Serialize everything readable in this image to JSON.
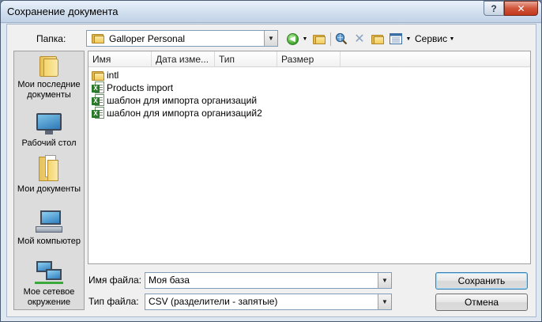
{
  "window": {
    "title": "Сохранение документа",
    "help_glyph": "?",
    "close_glyph": "✕"
  },
  "toolbar": {
    "folder_label": "Папка:",
    "folder_value": "Galloper Personal",
    "service_label": "Сервис"
  },
  "places": [
    {
      "label": "Мои последние документы",
      "icon": "recent-documents-icon"
    },
    {
      "label": "Рабочий стол",
      "icon": "desktop-icon"
    },
    {
      "label": "Мои документы",
      "icon": "my-documents-icon"
    },
    {
      "label": "Мой компьютер",
      "icon": "my-computer-icon"
    },
    {
      "label": "Мое сетевое окружение",
      "icon": "network-places-icon"
    }
  ],
  "filelist": {
    "columns": [
      "Имя",
      "Дата изме...",
      "Тип",
      "Размер"
    ],
    "items": [
      {
        "name": "intl",
        "icon": "folder-icon"
      },
      {
        "name": "Products import",
        "icon": "excel-file-icon"
      },
      {
        "name": "шаблон для импорта организаций",
        "icon": "excel-file-icon"
      },
      {
        "name": "шаблон для импорта организаций2",
        "icon": "excel-file-icon"
      }
    ]
  },
  "bottom": {
    "filename_label": "Имя файла:",
    "filename_value": "Моя база",
    "filetype_label": "Тип файла:",
    "filetype_value": "CSV (разделители - запятые)",
    "save_label": "Сохранить",
    "cancel_label": "Отмена"
  },
  "colors": {
    "title_gradient_top": "#e9f1fa",
    "close_button": "#c2381d",
    "dialog_bg": "#f0f0f0",
    "field_border": "#7f9db9"
  }
}
